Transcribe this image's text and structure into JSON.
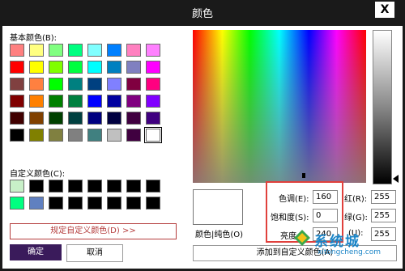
{
  "window": {
    "title": "颜色",
    "close_symbol": "X"
  },
  "basic_colors": {
    "label": "基本颜色(B):",
    "swatches": [
      "#ff8080",
      "#ffff80",
      "#80ff80",
      "#00ff80",
      "#80ffff",
      "#0080ff",
      "#ff80c0",
      "#ff80ff",
      "#ff0000",
      "#ffff00",
      "#80ff00",
      "#00ff40",
      "#00ffff",
      "#0080c0",
      "#8080c0",
      "#ff00ff",
      "#804040",
      "#ff8040",
      "#00ff00",
      "#008080",
      "#004080",
      "#8080ff",
      "#800040",
      "#ff0080",
      "#800000",
      "#ff8000",
      "#008000",
      "#008040",
      "#0000ff",
      "#0000a0",
      "#800080",
      "#8000ff",
      "#400000",
      "#804000",
      "#004000",
      "#004040",
      "#000080",
      "#000040",
      "#400040",
      "#400080",
      "#000000",
      "#808000",
      "#808040",
      "#808080",
      "#408080",
      "#c0c0c0",
      "#400040",
      "#ffffff"
    ]
  },
  "custom_colors": {
    "label": "自定义颜色(C):",
    "swatches": [
      "#c8f0c8",
      "#000000",
      "#000000",
      "#000000",
      "#000000",
      "#000000",
      "#000000",
      "#000000",
      "#00ff80",
      "#6080c0",
      "#000000",
      "#000000",
      "#000000",
      "#000000",
      "#000000",
      "#000000"
    ]
  },
  "buttons": {
    "define_custom": "规定自定义颜色(D) >>",
    "ok": "确定",
    "cancel": "取消",
    "add_custom": "添加到自定义颜色(A)"
  },
  "preview_label": "颜色|纯色(O)",
  "fields": {
    "hue": {
      "label": "色调(E):",
      "value": "160"
    },
    "sat": {
      "label": "饱和度(S):",
      "value": "0"
    },
    "lum": {
      "label": "亮度",
      "value": "240"
    },
    "red": {
      "label": "红(R):",
      "value": "255"
    },
    "green": {
      "label": "绿(G):",
      "value": "255"
    },
    "blue": {
      "label": "(U):",
      "value": "255"
    }
  },
  "watermark": {
    "text": "系统城",
    "url": "xitongcheng.com",
    "color": "#1a84c7"
  }
}
